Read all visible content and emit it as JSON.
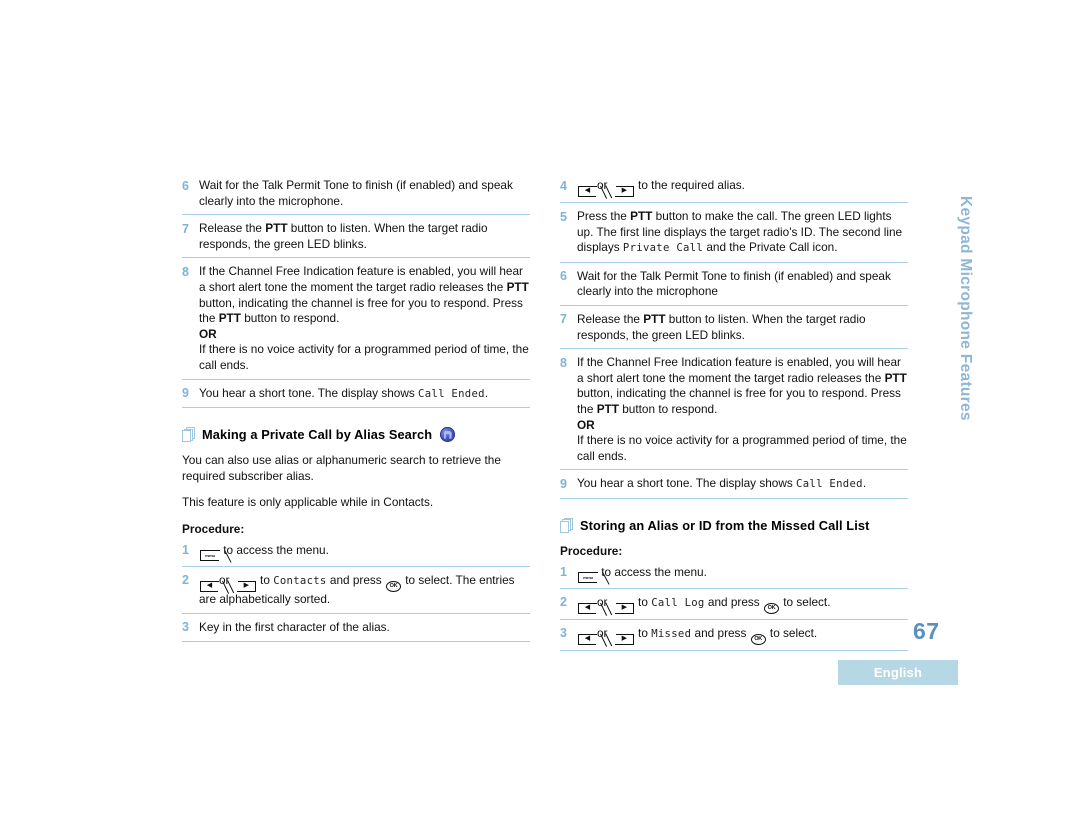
{
  "document": {
    "page_number": "67",
    "language_label": "English",
    "side_tab": "Keypad Microphone Features"
  },
  "icons": {
    "menu_key": "menu",
    "ok_key": "OK",
    "left_key": "◀",
    "right_key": "▶"
  },
  "left_column": {
    "steps": [
      {
        "num": "6",
        "parts": [
          {
            "t": "Wait for the Talk Permit Tone to finish (if enabled) and speak clearly into the microphone."
          }
        ]
      },
      {
        "num": "7",
        "parts": [
          {
            "t": "Release the "
          },
          {
            "t": "PTT",
            "bold": true
          },
          {
            "t": " button to listen. When the target radio responds, the green LED blinks."
          }
        ]
      },
      {
        "num": "8",
        "parts": [
          {
            "t": "If the Channel Free Indication feature is enabled, you will hear a short alert tone the moment the target radio releases the "
          },
          {
            "t": "PTT",
            "bold": true
          },
          {
            "t": " button, indicating the channel is free for you to respond. Press the "
          },
          {
            "t": "PTT",
            "bold": true
          },
          {
            "t": " button to respond."
          },
          {
            "t": "OR",
            "bold": true,
            "newline": true
          },
          {
            "t": "If there is no voice activity for a programmed period of time, the call ends.",
            "newline": true
          }
        ]
      },
      {
        "num": "9",
        "parts": [
          {
            "t": "You hear a short tone. The display shows "
          },
          {
            "t": "Call Ended",
            "disp": true
          },
          {
            "t": "."
          }
        ]
      }
    ],
    "section": {
      "title": "Making a Private Call by Alias Search",
      "has_round_icon": true,
      "paragraphs": [
        "You can also use alias or alphanumeric search to retrieve the required subscriber alias.",
        "This feature is only applicable while in Contacts."
      ],
      "procedure_label": "Procedure:",
      "procedure": [
        {
          "num": "1",
          "parts": [
            {
              "key": "menu"
            },
            {
              "t": " to access the menu."
            }
          ]
        },
        {
          "num": "2",
          "parts": [
            {
              "key": "left"
            },
            {
              "t": "or "
            },
            {
              "key": "right"
            },
            {
              "t": " to "
            },
            {
              "t": "Contacts",
              "disp": true
            },
            {
              "t": " and press "
            },
            {
              "key": "ok"
            },
            {
              "t": " to select. The entries are alphabetically sorted."
            }
          ]
        },
        {
          "num": "3",
          "parts": [
            {
              "t": "Key in the first character of the alias."
            }
          ]
        }
      ]
    }
  },
  "right_column": {
    "steps": [
      {
        "num": "4",
        "parts": [
          {
            "key": "left"
          },
          {
            "t": "or "
          },
          {
            "key": "right"
          },
          {
            "t": " to the required alias."
          }
        ]
      },
      {
        "num": "5",
        "parts": [
          {
            "t": "Press the "
          },
          {
            "t": "PTT",
            "bold": true
          },
          {
            "t": " button to make the call. The green LED lights up. The first line displays the target radio's ID. The second line displays "
          },
          {
            "t": "Private Call",
            "disp": true
          },
          {
            "t": " and the Private Call icon."
          }
        ]
      },
      {
        "num": "6",
        "parts": [
          {
            "t": "Wait for the Talk Permit Tone to finish (if enabled) and speak clearly into the microphone"
          }
        ]
      },
      {
        "num": "7",
        "parts": [
          {
            "t": "Release the "
          },
          {
            "t": "PTT",
            "bold": true
          },
          {
            "t": " button to listen. When the target radio responds, the green LED blinks."
          }
        ]
      },
      {
        "num": "8",
        "parts": [
          {
            "t": "If the Channel Free Indication feature is enabled, you will hear a short alert tone the moment the target radio releases the "
          },
          {
            "t": "PTT",
            "bold": true
          },
          {
            "t": " button, indicating the channel is free for you to respond. Press the "
          },
          {
            "t": "PTT",
            "bold": true
          },
          {
            "t": " button to respond."
          },
          {
            "t": "OR",
            "bold": true,
            "newline": true
          },
          {
            "t": "If there is no voice activity for a programmed period of time, the call ends.",
            "newline": true
          }
        ]
      },
      {
        "num": "9",
        "parts": [
          {
            "t": "You hear a short tone. The display shows "
          },
          {
            "t": "Call Ended",
            "disp": true
          },
          {
            "t": "."
          }
        ]
      }
    ],
    "section": {
      "title": "Storing an Alias or ID from the Missed Call List",
      "has_round_icon": false,
      "procedure_label": "Procedure:",
      "procedure": [
        {
          "num": "1",
          "parts": [
            {
              "key": "menu"
            },
            {
              "t": " to access the menu."
            }
          ]
        },
        {
          "num": "2",
          "parts": [
            {
              "key": "left"
            },
            {
              "t": "or "
            },
            {
              "key": "right"
            },
            {
              "t": " to "
            },
            {
              "t": "Call Log",
              "disp": true
            },
            {
              "t": " and press "
            },
            {
              "key": "ok"
            },
            {
              "t": " to select."
            }
          ]
        },
        {
          "num": "3",
          "parts": [
            {
              "key": "left"
            },
            {
              "t": "or "
            },
            {
              "key": "right"
            },
            {
              "t": " to "
            },
            {
              "t": "Missed",
              "disp": true
            },
            {
              "t": " and press "
            },
            {
              "key": "ok"
            },
            {
              "t": " to select."
            }
          ]
        }
      ]
    }
  }
}
